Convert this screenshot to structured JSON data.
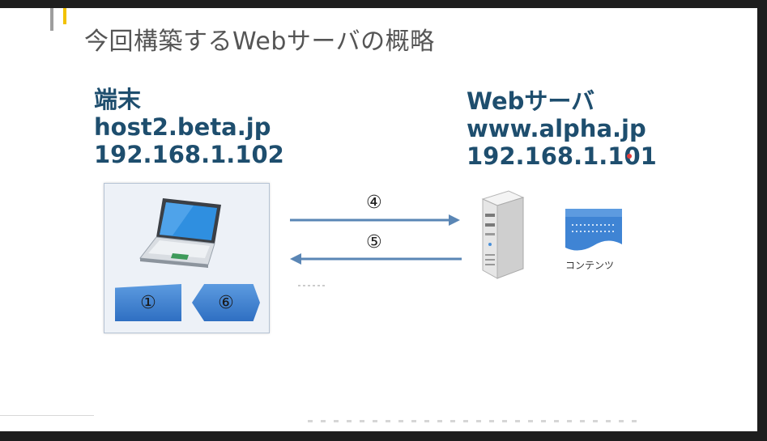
{
  "slide": {
    "title": "今回構築するWebサーバの概略"
  },
  "terminal": {
    "role": "端末",
    "hostname": "host2.beta.jp",
    "ip": "192.168.1.102",
    "steps": {
      "step1": "①",
      "step6": "⑥"
    }
  },
  "server": {
    "role": "Webサーバ",
    "hostname": "www.alpha.jp",
    "ip": "192.168.1.101",
    "content_caption": "コンテンツ"
  },
  "arrows": {
    "request_step": "④",
    "response_step": "⑤"
  },
  "colors": {
    "heading_text": "#1e4e6e",
    "title_text": "#555555",
    "arrow": "#5a86b5",
    "tag_fill": "#3f84d4",
    "accent_yellow": "#f2c200"
  },
  "icons": [
    "laptop-icon",
    "server-tower-icon",
    "document-icon"
  ]
}
